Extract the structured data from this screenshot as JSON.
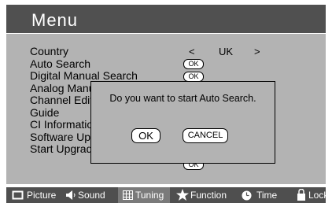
{
  "menu": {
    "title": "Menu",
    "items": [
      "Country",
      "Auto Search",
      "Digital Manual Search",
      "Analog Manual Search",
      "Channel Edit",
      "Guide",
      "CI Information",
      "Software Update",
      "Start Upgrade"
    ],
    "country": {
      "left_arrow": "<",
      "value": "UK",
      "right_arrow": ">"
    },
    "ok_label": "OK"
  },
  "dialog": {
    "message": "Do you want to start Auto Search.",
    "ok_label": "OK",
    "cancel_label": "CANCEL"
  },
  "tabs": [
    {
      "label": "Picture",
      "icon": "picture-icon"
    },
    {
      "label": "Sound",
      "icon": "speaker-icon"
    },
    {
      "label": "Tuning",
      "icon": "grid-icon",
      "active": true
    },
    {
      "label": "Function",
      "icon": "star-icon"
    },
    {
      "label": "Time",
      "icon": "clock-icon"
    },
    {
      "label": "Lock",
      "icon": "lock-icon"
    }
  ],
  "colors": {
    "title_bar": "#505050",
    "panel": "#b3b3b3",
    "bottom_bar": "#4f4f4f",
    "active_tab": "#7a7a7a"
  }
}
